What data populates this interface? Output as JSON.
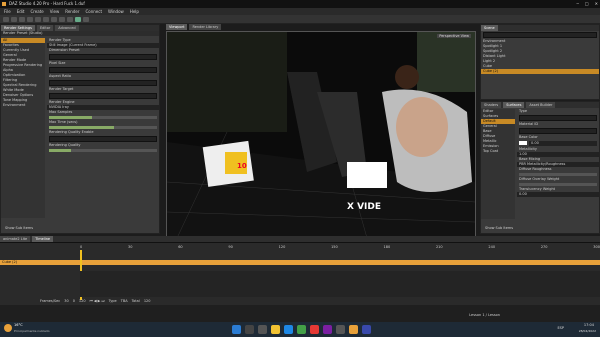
{
  "window": {
    "title": "DAZ Studio 4.20 Pro - Hard Fuck 1.duf"
  },
  "menu": [
    "File",
    "Edit",
    "Create",
    "View",
    "Render",
    "Connect",
    "Window",
    "Help"
  ],
  "left_panel": {
    "tabs": [
      "Render Settings",
      "Editor",
      "Advanced"
    ],
    "preset": "Render Preset (Studio)",
    "rows": [
      {
        "label": "All",
        "hl": true
      },
      {
        "label": "Favorites"
      },
      {
        "label": "Currently Used"
      },
      {
        "label": "General"
      },
      {
        "label": "Render Mode"
      },
      {
        "label": "Progressive Rendering"
      },
      {
        "label": "Alpha"
      },
      {
        "label": "Optimization"
      },
      {
        "label": "Filtering"
      },
      {
        "label": "Spectral Rendering"
      },
      {
        "label": "White Mode"
      },
      {
        "label": "Denoiser Options"
      },
      {
        "label": "Tone Mapping"
      },
      {
        "label": "Environment"
      }
    ],
    "props": [
      "Render Type",
      "Still Image (Current Frame)",
      "Dimension Preset",
      "Pixel Size",
      "Aspect Ratio",
      "Render Target",
      "Render Engine",
      "NVIDIA Iray",
      "Max Samples",
      "Max Time (secs)",
      "Rendering Quality Enable",
      "Rendering Quality"
    ],
    "footer": "Show Sub Items"
  },
  "viewport": {
    "tabs": [
      "Viewport",
      "Render Library"
    ],
    "camera": "Perspective View",
    "logo_text": "X VIDE"
  },
  "right_panel": {
    "tabs": [
      "Scene"
    ],
    "scene_items": [
      "Environment",
      "Spotlight 1",
      "Spotlight 2",
      "Distant Light",
      "Light 2",
      "Cube",
      "Cube (2)"
    ],
    "tabs2": [
      "Shaders",
      "Surfaces",
      "Asset Builder"
    ],
    "surface_tree": [
      "Editor",
      "Surfaces",
      "Default",
      "General",
      "Base",
      "Diffuse",
      "Metallic",
      "Emission",
      "Top Coat"
    ],
    "props": [
      "Type",
      "Material ID",
      "Base Color",
      "Metallicity",
      "Base Mixing",
      "PBR Metallicity/Roughness",
      "Diffuse Roughness",
      "Diffuse Overlay Weight",
      "Translucency Weight"
    ],
    "values": [
      "0.00",
      "1.00",
      "0.00"
    ],
    "footer": "Show Sub Items"
  },
  "timeline": {
    "tabs": [
      "animate2 Lite",
      "Timeline"
    ],
    "track": "Cube (2)",
    "ticks": [
      "0",
      "30",
      "60",
      "90",
      "120",
      "150",
      "180",
      "210",
      "240",
      "270",
      "300"
    ],
    "fps_label": "Frames/Sec",
    "fps": "30",
    "start": "0",
    "end": "120",
    "type_label": "Type",
    "type": "TBA",
    "total_label": "Total",
    "total": "120",
    "lesson": "Lesson 1 / Lesson"
  },
  "taskbar": {
    "weather": "16°C",
    "weather_sub": "Principalmente nublado",
    "time": "17:04",
    "date": "28/04/2022",
    "lang": "ESP"
  }
}
